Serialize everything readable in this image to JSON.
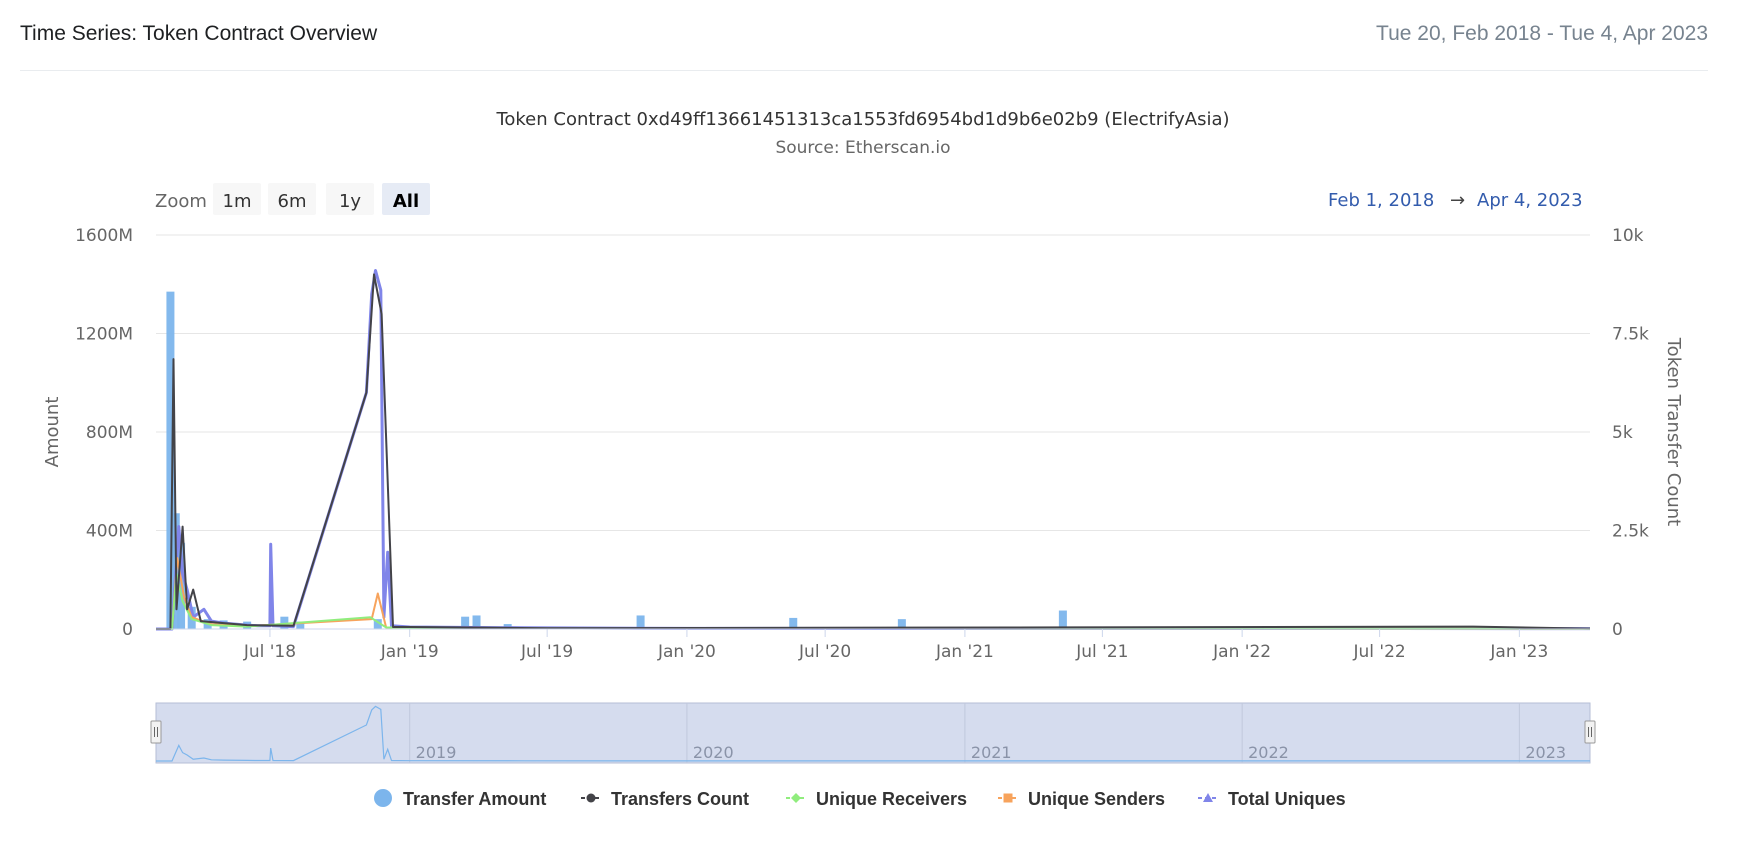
{
  "header": {
    "title": "Time Series: Token Contract Overview",
    "date_range": "Tue 20, Feb 2018 - Tue 4, Apr 2023"
  },
  "chart_data": {
    "type": "line",
    "title": "Token Contract 0xd49ff13661451313ca1553fd6954bd1d9b6e02b9 (ElectrifyAsia)",
    "subtitle": "Source: Etherscan.io",
    "zoom": {
      "label": "Zoom",
      "buttons": [
        "1m",
        "6m",
        "1y",
        "All"
      ],
      "selected": "All"
    },
    "range_selector": {
      "from": "Feb 1, 2018",
      "arrow": "→",
      "to": "Apr 4, 2023"
    },
    "x_range": [
      "2018-02-01",
      "2023-04-04"
    ],
    "x_ticks": [
      "Jul '18",
      "Jan '19",
      "Jul '19",
      "Jan '20",
      "Jul '20",
      "Jan '21",
      "Jul '21",
      "Jan '22",
      "Jul '22",
      "Jan '23"
    ],
    "y_left": {
      "label": "Amount",
      "ylim": [
        0,
        1600000000
      ],
      "ticks": [
        "0",
        "400M",
        "800M",
        "1200M",
        "1600M"
      ]
    },
    "y_right": {
      "label": "Token Transfer Count",
      "ylim": [
        0,
        10000
      ],
      "ticks": [
        "0",
        "2.5k",
        "5k",
        "7.5k",
        "10k"
      ]
    },
    "grid": true,
    "legend_position": "bottom",
    "navigator_labels": [
      "2019",
      "2020",
      "2021",
      "2022",
      "2023"
    ],
    "series": [
      {
        "name": "Transfer Amount",
        "axis": "left",
        "kind": "column",
        "color": "#7cb5ec",
        "points": [
          [
            "2018-02-20",
            1370000000
          ],
          [
            "2018-02-27",
            470000000
          ],
          [
            "2018-03-06",
            350000000
          ],
          [
            "2018-03-20",
            90000000
          ],
          [
            "2018-04-10",
            40000000
          ],
          [
            "2018-05-01",
            35000000
          ],
          [
            "2018-06-01",
            30000000
          ],
          [
            "2018-07-20",
            50000000
          ],
          [
            "2018-08-10",
            30000000
          ],
          [
            "2018-11-20",
            40000000
          ],
          [
            "2019-03-15",
            50000000
          ],
          [
            "2019-03-30",
            55000000
          ],
          [
            "2019-05-10",
            20000000
          ],
          [
            "2019-11-01",
            55000000
          ],
          [
            "2020-05-20",
            45000000
          ],
          [
            "2020-10-10",
            40000000
          ],
          [
            "2021-05-10",
            75000000
          ]
        ]
      },
      {
        "name": "Transfers Count",
        "axis": "right",
        "kind": "line",
        "color": "#434348",
        "points": [
          [
            "2018-02-01",
            0
          ],
          [
            "2018-02-20",
            0
          ],
          [
            "2018-02-24",
            6850
          ],
          [
            "2018-02-28",
            500
          ],
          [
            "2018-03-08",
            2600
          ],
          [
            "2018-03-14",
            500
          ],
          [
            "2018-03-22",
            1000
          ],
          [
            "2018-04-01",
            200
          ],
          [
            "2018-05-01",
            150
          ],
          [
            "2018-06-01",
            100
          ],
          [
            "2018-08-01",
            80
          ],
          [
            "2018-11-05",
            6000
          ],
          [
            "2018-11-15",
            9000
          ],
          [
            "2018-11-25",
            8000
          ],
          [
            "2018-12-10",
            50
          ],
          [
            "2019-01-01",
            50
          ],
          [
            "2019-07-01",
            20
          ],
          [
            "2021-05-15",
            40
          ],
          [
            "2022-11-01",
            60
          ],
          [
            "2023-04-04",
            10
          ]
        ]
      },
      {
        "name": "Unique Receivers",
        "axis": "right",
        "kind": "line",
        "color": "#90ed7d",
        "points": [
          [
            "2018-02-01",
            0
          ],
          [
            "2018-02-22",
            0
          ],
          [
            "2018-02-28",
            1400
          ],
          [
            "2018-03-08",
            700
          ],
          [
            "2018-03-20",
            250
          ],
          [
            "2018-04-15",
            100
          ],
          [
            "2018-06-01",
            60
          ],
          [
            "2018-11-10",
            300
          ],
          [
            "2018-12-01",
            40
          ],
          [
            "2019-06-01",
            15
          ],
          [
            "2023-04-04",
            5
          ]
        ]
      },
      {
        "name": "Unique Senders",
        "axis": "right",
        "kind": "line",
        "color": "#f7a35c",
        "points": [
          [
            "2018-02-01",
            0
          ],
          [
            "2018-02-22",
            0
          ],
          [
            "2018-03-01",
            1800
          ],
          [
            "2018-03-10",
            800
          ],
          [
            "2018-03-20",
            300
          ],
          [
            "2018-04-15",
            120
          ],
          [
            "2018-06-01",
            70
          ],
          [
            "2018-11-12",
            250
          ],
          [
            "2018-11-20",
            900
          ],
          [
            "2018-12-01",
            40
          ],
          [
            "2019-06-01",
            15
          ],
          [
            "2023-04-04",
            5
          ]
        ]
      },
      {
        "name": "Total Uniques",
        "axis": "right",
        "kind": "line",
        "color": "#8085e9",
        "points": [
          [
            "2018-02-01",
            0
          ],
          [
            "2018-02-22",
            0
          ],
          [
            "2018-03-03",
            2600
          ],
          [
            "2018-03-08",
            1400
          ],
          [
            "2018-03-14",
            1000
          ],
          [
            "2018-03-22",
            300
          ],
          [
            "2018-04-05",
            500
          ],
          [
            "2018-04-15",
            200
          ],
          [
            "2018-05-01",
            150
          ],
          [
            "2018-06-01",
            100
          ],
          [
            "2018-06-15",
            80
          ],
          [
            "2018-07-01",
            80
          ],
          [
            "2018-07-02",
            2150
          ],
          [
            "2018-07-05",
            80
          ],
          [
            "2018-08-01",
            60
          ],
          [
            "2018-11-05",
            6000
          ],
          [
            "2018-11-12",
            8500
          ],
          [
            "2018-11-17",
            9100
          ],
          [
            "2018-11-24",
            8600
          ],
          [
            "2018-11-28",
            300
          ],
          [
            "2018-12-03",
            1950
          ],
          [
            "2018-12-08",
            80
          ],
          [
            "2019-01-01",
            50
          ],
          [
            "2019-06-01",
            30
          ],
          [
            "2020-01-01",
            15
          ],
          [
            "2023-04-04",
            10
          ]
        ]
      }
    ]
  }
}
